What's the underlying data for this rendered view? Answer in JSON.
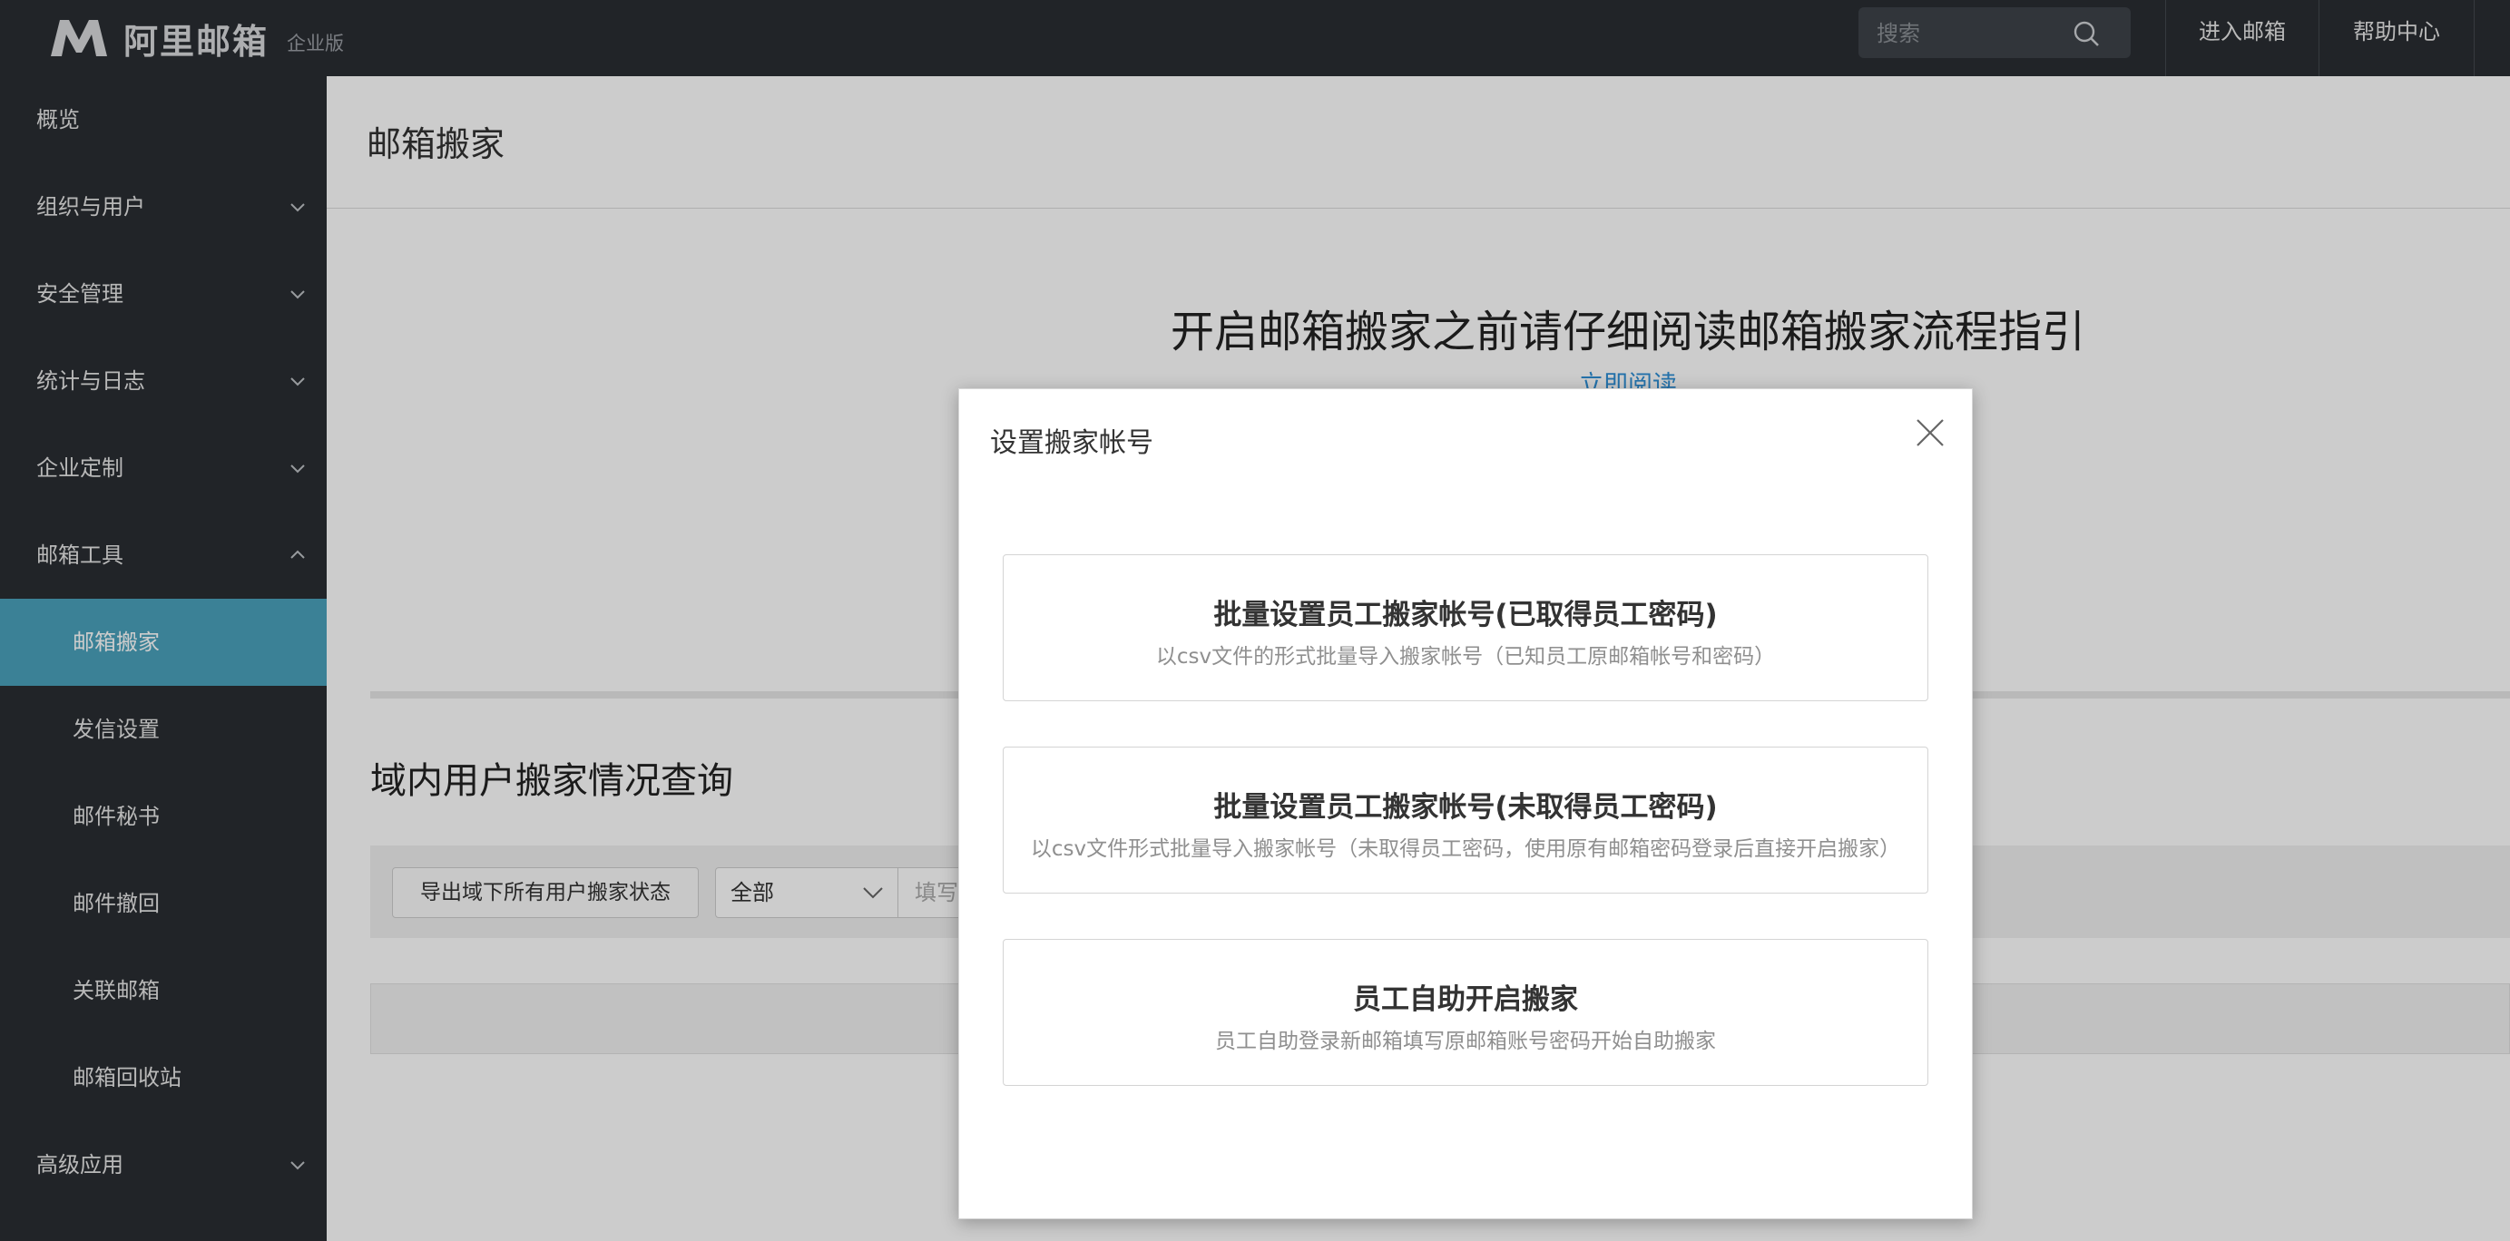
{
  "topbar": {
    "logo_text": "阿里邮箱",
    "logo_sub": "企业版",
    "search_placeholder": "搜索",
    "links": [
      "进入邮箱",
      "帮助中心"
    ]
  },
  "sidebar": {
    "items": [
      {
        "label": "概览",
        "expandable": false
      },
      {
        "label": "组织与用户",
        "expandable": true
      },
      {
        "label": "安全管理",
        "expandable": true
      },
      {
        "label": "统计与日志",
        "expandable": true
      },
      {
        "label": "企业定制",
        "expandable": true
      },
      {
        "label": "邮箱工具",
        "expandable": true,
        "expanded": true
      },
      {
        "label": "邮箱搬家",
        "child": true,
        "active": true
      },
      {
        "label": "发信设置",
        "child": true
      },
      {
        "label": "邮件秘书",
        "child": true
      },
      {
        "label": "邮件撤回",
        "child": true
      },
      {
        "label": "关联邮箱",
        "child": true
      },
      {
        "label": "邮箱回收站",
        "child": true
      },
      {
        "label": "高级应用",
        "expandable": true
      }
    ]
  },
  "main": {
    "page_title": "邮箱搬家",
    "guide_title": "开启邮箱搬家之前请仔细阅读邮箱搬家流程指引",
    "guide_link": "立即阅读",
    "query_title": "域内用户搬家情况查询",
    "export_button": "导出域下所有用户搬家状态",
    "status_select": "全部",
    "fill_placeholder": "填写"
  },
  "modal": {
    "title": "设置搬家帐号",
    "options": [
      {
        "title": "批量设置员工搬家帐号(已取得员工密码)",
        "desc": "以csv文件的形式批量导入搬家帐号（已知员工原邮箱帐号和密码）"
      },
      {
        "title": "批量设置员工搬家帐号(未取得员工密码)",
        "desc": "以csv文件形式批量导入搬家帐号（未取得员工密码，使用原有邮箱密码登录后直接开启搬家）"
      },
      {
        "title": "员工自助开启搬家",
        "desc": "员工自助登录新邮箱填写原邮箱账号密码开始自助搬家"
      }
    ]
  },
  "colors": {
    "topbar_bg": "#2a2e33",
    "sidebar_bg": "#2a2e33",
    "active_item": "#4aa2bc",
    "link": "#2e8fd6"
  }
}
